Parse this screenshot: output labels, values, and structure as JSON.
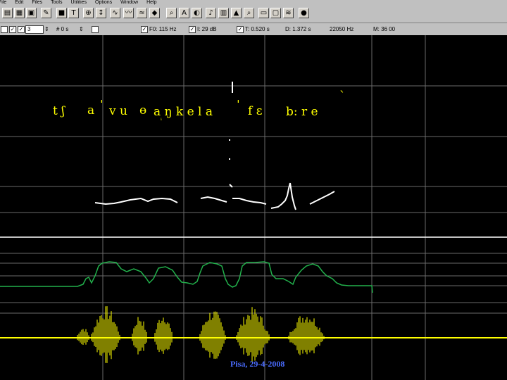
{
  "menu": [
    "File",
    "Edit",
    "Files",
    "Tools",
    "Utilities",
    "Options",
    "Window",
    "Help"
  ],
  "toolbar_icons": [
    "open-icon",
    "save-icon",
    "grid-icon",
    "paint-icon",
    "stop-icon",
    "text-icon",
    "zoom-icon",
    "arrow-icon",
    "wave-icon",
    "waveform-icon",
    "signal-icon",
    "mask-icon",
    "magnify-icon",
    "a-icon",
    "speaker-icon",
    "note-icon",
    "calc-icon",
    "graph-icon",
    "lens-icon",
    "page-icon",
    "frame-icon",
    "filter-icon",
    "color-icon"
  ],
  "status": {
    "check1": "",
    "check2": "",
    "field_value": "3",
    "step_label": "# 0 s",
    "f0": "F0: 115 Hz",
    "intensity": "I: 29 dB",
    "time": "T: 0.520 s",
    "duration": "D: 1.372 s",
    "rate": "22050 Hz",
    "mem": "M: 36 00"
  },
  "transcription": {
    "segments": [
      "t ʃ",
      "a",
      "ˈ",
      "v u",
      "ɵ",
      "ᵢ",
      "a ŋ k e l a",
      "ˈ",
      "f ɛ",
      "b: r e",
      "ˋ"
    ]
  },
  "caption": "Pisa, 29-4-2008",
  "colors": {
    "background": "#000000",
    "grid": "#6a6a6a",
    "ipa": "#ffff00",
    "pitch": "#ffffff",
    "intensity": "#22b14c",
    "wave": "#ffff00",
    "caption": "#4a6cff"
  }
}
